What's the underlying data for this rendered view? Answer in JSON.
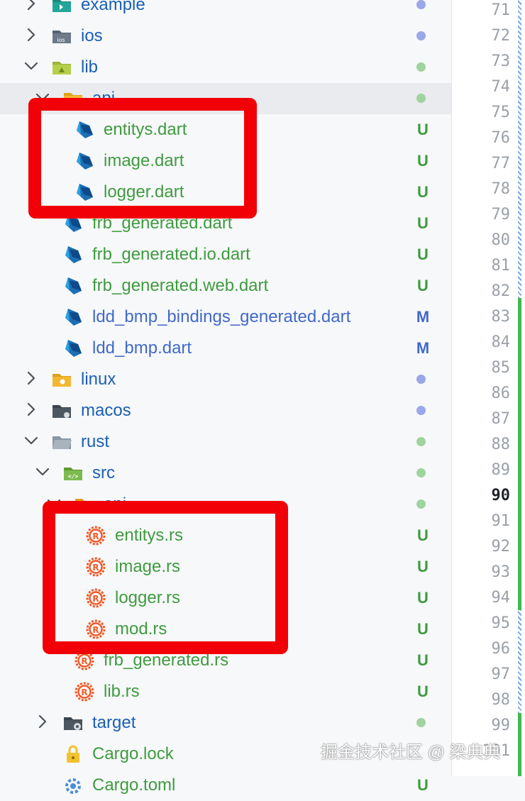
{
  "colors": {
    "folder_label": "#1a5fb4",
    "untracked": "#3f9b3f",
    "modified": "#4169c8",
    "dot_blue": "#9aa7e8",
    "dot_green": "#9fd39f",
    "highlight": "#f20007"
  },
  "tree": [
    {
      "label": "example",
      "kind": "folder",
      "icon": "folder-example-icon",
      "chevron": "right",
      "status": "dot-blue"
    },
    {
      "label": "ios",
      "kind": "folder",
      "icon": "folder-ios-icon",
      "chevron": "right",
      "status": "dot-blue"
    },
    {
      "label": "lib",
      "kind": "folder",
      "icon": "folder-lib-icon",
      "chevron": "down",
      "status": "dot-green"
    },
    {
      "label": "api",
      "kind": "folder",
      "icon": "folder-api-icon",
      "chevron": "down",
      "status": "dot-green",
      "selected": true
    },
    {
      "label": "entitys.dart",
      "kind": "file",
      "icon": "dart-icon",
      "badge": "U"
    },
    {
      "label": "image.dart",
      "kind": "file",
      "icon": "dart-icon",
      "badge": "U"
    },
    {
      "label": "logger.dart",
      "kind": "file",
      "icon": "dart-icon",
      "badge": "U"
    },
    {
      "label": "frb_generated.dart",
      "kind": "file",
      "icon": "dart-icon",
      "badge": "U"
    },
    {
      "label": "frb_generated.io.dart",
      "kind": "file",
      "icon": "dart-icon",
      "badge": "U"
    },
    {
      "label": "frb_generated.web.dart",
      "kind": "file",
      "icon": "dart-icon",
      "badge": "U"
    },
    {
      "label": "ldd_bmp_bindings_generated.dart",
      "kind": "file",
      "icon": "dart-icon",
      "badge": "M"
    },
    {
      "label": "ldd_bmp.dart",
      "kind": "file",
      "icon": "dart-icon",
      "badge": "M"
    },
    {
      "label": "linux",
      "kind": "folder",
      "icon": "folder-linux-icon",
      "chevron": "right",
      "status": "dot-blue"
    },
    {
      "label": "macos",
      "kind": "folder",
      "icon": "folder-macos-icon",
      "chevron": "right",
      "status": "dot-blue"
    },
    {
      "label": "rust",
      "kind": "folder",
      "icon": "folder-rust-icon",
      "chevron": "down",
      "status": "dot-green"
    },
    {
      "label": "src",
      "kind": "folder",
      "icon": "folder-src-icon",
      "chevron": "down",
      "status": "dot-green"
    },
    {
      "label": "api",
      "kind": "folder",
      "icon": "folder-api-icon",
      "chevron": "down",
      "status": "dot-green"
    },
    {
      "label": "entitys.rs",
      "kind": "file",
      "icon": "rust-icon",
      "badge": "U"
    },
    {
      "label": "image.rs",
      "kind": "file",
      "icon": "rust-icon",
      "badge": "U"
    },
    {
      "label": "logger.rs",
      "kind": "file",
      "icon": "rust-icon",
      "badge": "U"
    },
    {
      "label": "mod.rs",
      "kind": "file",
      "icon": "rust-icon",
      "badge": "U"
    },
    {
      "label": "frb_generated.rs",
      "kind": "file",
      "icon": "rust-icon",
      "badge": "U"
    },
    {
      "label": "lib.rs",
      "kind": "file",
      "icon": "rust-icon",
      "badge": "U"
    },
    {
      "label": "target",
      "kind": "folder",
      "icon": "folder-target-icon",
      "chevron": "right",
      "status": "dot-green"
    },
    {
      "label": "Cargo.lock",
      "kind": "file",
      "icon": "lock-icon",
      "badge": ""
    },
    {
      "label": "Cargo.toml",
      "kind": "file",
      "icon": "gear-icon",
      "badge": "U"
    }
  ],
  "gutter": {
    "lines": [
      "71",
      "72",
      "73",
      "74",
      "75",
      "76",
      "77",
      "78",
      "79",
      "80",
      "81",
      "82",
      "83",
      "84",
      "85",
      "86",
      "87",
      "88",
      "89",
      "90",
      "91",
      "92",
      "93",
      "94",
      "95",
      "96",
      "97",
      "98",
      "99",
      "101"
    ],
    "current_line": "90"
  },
  "watermark": "掘金技术社区 @ 梁典典"
}
